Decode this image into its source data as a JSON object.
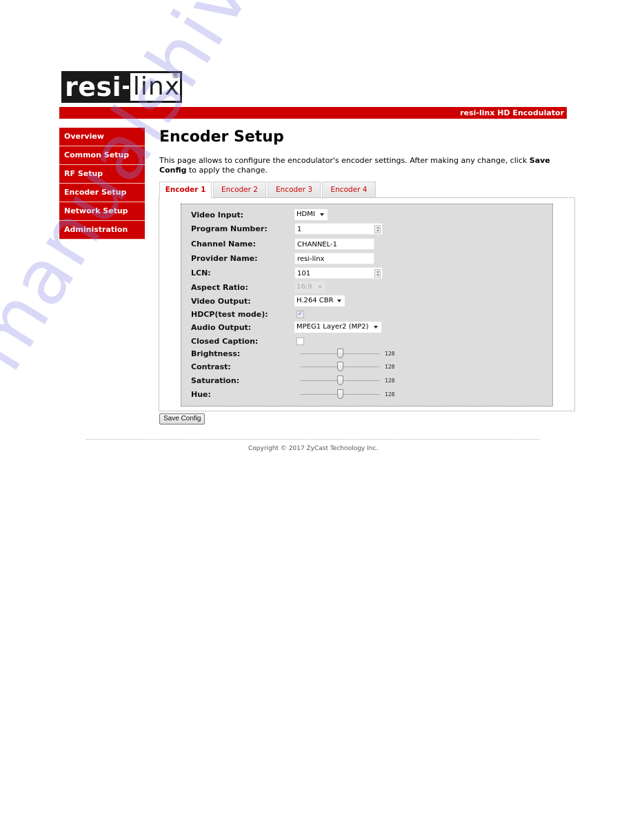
{
  "logo": {
    "left": "resi",
    "right": "linx",
    "registered": "®"
  },
  "header": {
    "product_name": "resi-linx HD Encodulator"
  },
  "sidebar": {
    "items": [
      {
        "label": "Overview"
      },
      {
        "label": "Common Setup"
      },
      {
        "label": "RF Setup"
      },
      {
        "label": "Encoder Setup"
      },
      {
        "label": "Network Setup"
      },
      {
        "label": "Administration"
      }
    ]
  },
  "main": {
    "title": "Encoder Setup",
    "intro_pre": "This page allows to configure the encodulator's encoder settings. After making any change, click ",
    "intro_bold": "Save Config",
    "intro_post": " to apply the change.",
    "tabs": [
      {
        "label": "Encoder 1",
        "active": true
      },
      {
        "label": "Encoder 2",
        "active": false
      },
      {
        "label": "Encoder 3",
        "active": false
      },
      {
        "label": "Encoder 4",
        "active": false
      }
    ],
    "form": {
      "video_input": {
        "label": "Video Input:",
        "value": "HDMI"
      },
      "program_number": {
        "label": "Program Number:",
        "value": "1"
      },
      "channel_name": {
        "label": "Channel Name:",
        "value": "CHANNEL-1"
      },
      "provider_name": {
        "label": "Provider Name:",
        "value": "resi-linx"
      },
      "lcn": {
        "label": "LCN:",
        "value": "101"
      },
      "aspect_ratio": {
        "label": "Aspect Ratio:",
        "value": "16:9",
        "disabled": true
      },
      "video_output": {
        "label": "Video Output:",
        "value": "H.264 CBR"
      },
      "hdcp": {
        "label": "HDCP(test mode):",
        "checked": true,
        "check_glyph": "✓"
      },
      "audio_output": {
        "label": "Audio Output:",
        "value": "MPEG1 Layer2 (MP2)"
      },
      "closed_caption": {
        "label": "Closed Caption:",
        "checked": false
      },
      "brightness": {
        "label": "Brightness:",
        "value": "128",
        "fraction": 0.5
      },
      "contrast": {
        "label": "Contrast:",
        "value": "128",
        "fraction": 0.5
      },
      "saturation": {
        "label": "Saturation:",
        "value": "128",
        "fraction": 0.5
      },
      "hue": {
        "label": "Hue:",
        "value": "128",
        "fraction": 0.5
      }
    },
    "save_label": "Save Config"
  },
  "footer": {
    "copyright": "Copyright © 2017 ZyCast Technology Inc."
  },
  "watermark": "manualshive.com",
  "colors": {
    "brand_red": "#cc0000",
    "form_bg": "#dddddd"
  }
}
